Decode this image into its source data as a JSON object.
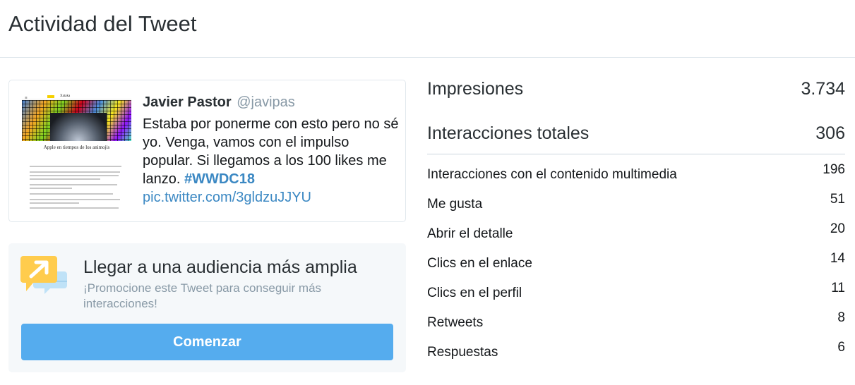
{
  "header": {
    "title": "Actividad del Tweet"
  },
  "tweet": {
    "author_name": "Javier Pastor",
    "author_handle": "@javipas",
    "text": "Estaba por ponerme con esto pero no sé yo. Venga, vamos con el impulso popular. Si llegamos a los 100 likes me lanzo. ",
    "hashtag": "#WWDC18",
    "link": "pic.twitter.com/3gldzuJJYU",
    "thumbnail": {
      "site_name": "Xataka",
      "headline": "Apple en tiempos de los animojis"
    }
  },
  "promo": {
    "title": "Llegar a una audiencia más amplia",
    "subtitle": "¡Promocione este Tweet para conseguir más interacciones!",
    "button_label": "Comenzar",
    "icon": "megaphone-chat-icon"
  },
  "stats": {
    "impressions": {
      "label": "Impresiones",
      "value": "3.734"
    },
    "total_interactions": {
      "label": "Interacciones totales",
      "value": "306"
    },
    "breakdown": [
      {
        "label": "Interacciones con el contenido multimedia",
        "value": "196"
      },
      {
        "label": "Me gusta",
        "value": "51"
      },
      {
        "label": "Abrir el detalle",
        "value": "20"
      },
      {
        "label": "Clics en el enlace",
        "value": "14"
      },
      {
        "label": "Clics en el perfil",
        "value": "11"
      },
      {
        "label": "Retweets",
        "value": "8"
      },
      {
        "label": "Respuestas",
        "value": "6"
      }
    ]
  },
  "colors": {
    "accent": "#55acee",
    "link": "#3b88c3",
    "muted": "#8899a6",
    "promo_bg": "#f5f8fa",
    "icon_yellow": "#ffcc4d",
    "icon_blue": "#bfe2f7"
  }
}
